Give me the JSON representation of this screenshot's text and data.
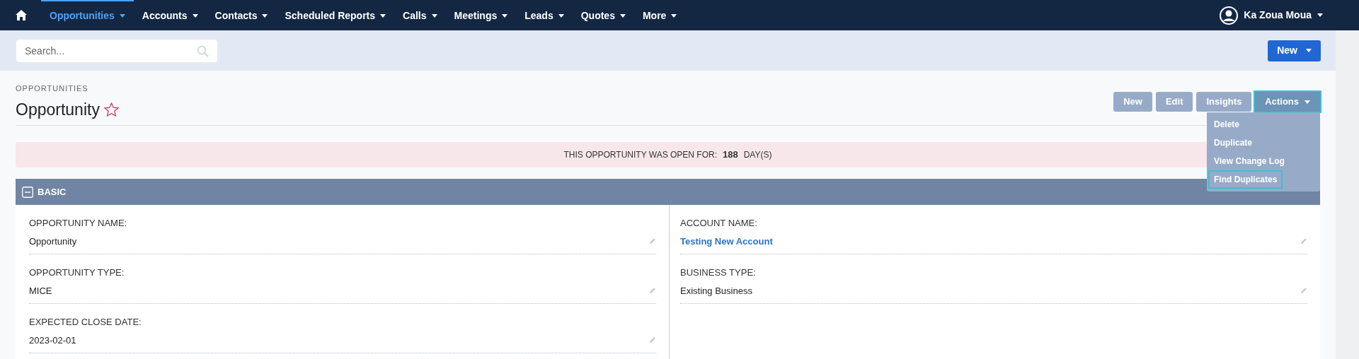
{
  "nav": {
    "items": [
      {
        "label": "Opportunities",
        "selected": true
      },
      {
        "label": "Accounts",
        "selected": false
      },
      {
        "label": "Contacts",
        "selected": false
      },
      {
        "label": "Scheduled Reports",
        "selected": false
      },
      {
        "label": "Calls",
        "selected": false
      },
      {
        "label": "Meetings",
        "selected": false
      },
      {
        "label": "Leads",
        "selected": false
      },
      {
        "label": "Quotes",
        "selected": false
      },
      {
        "label": "More",
        "selected": false
      }
    ],
    "user": "Ka Zoua Moua"
  },
  "search": {
    "placeholder": "Search..."
  },
  "new_button": "New",
  "breadcrumb": "OPPORTUNITIES",
  "title": "Opportunity",
  "favorite": false,
  "action_buttons": [
    {
      "label": "New",
      "kind": "plain"
    },
    {
      "label": "Edit",
      "kind": "plain"
    },
    {
      "label": "Insights",
      "kind": "plain"
    },
    {
      "label": "Actions",
      "kind": "menu"
    }
  ],
  "actions_menu": {
    "expanded": true,
    "items": [
      {
        "label": "Delete",
        "selected": false
      },
      {
        "label": "Duplicate",
        "selected": false
      },
      {
        "label": "View Change Log",
        "selected": false
      },
      {
        "label": "Find Duplicates",
        "selected": true
      }
    ]
  },
  "banner": {
    "text": "THIS OPPORTUNITY WAS OPEN FOR:",
    "days": "188",
    "unit": "DAY(S)"
  },
  "panel": {
    "title": "BASIC",
    "expanded": true,
    "left": [
      {
        "label": "OPPORTUNITY NAME:",
        "value": "Opportunity",
        "kind": "text"
      },
      {
        "label": "OPPORTUNITY TYPE:",
        "value": "MICE",
        "kind": "text"
      },
      {
        "label": "EXPECTED CLOSE DATE:",
        "value": "2023-02-01",
        "kind": "text"
      }
    ],
    "right": [
      {
        "label": "ACCOUNT NAME:",
        "value": "Testing New Account",
        "kind": "link"
      },
      {
        "label": "BUSINESS TYPE:",
        "value": "Existing Business",
        "kind": "text"
      }
    ]
  }
}
